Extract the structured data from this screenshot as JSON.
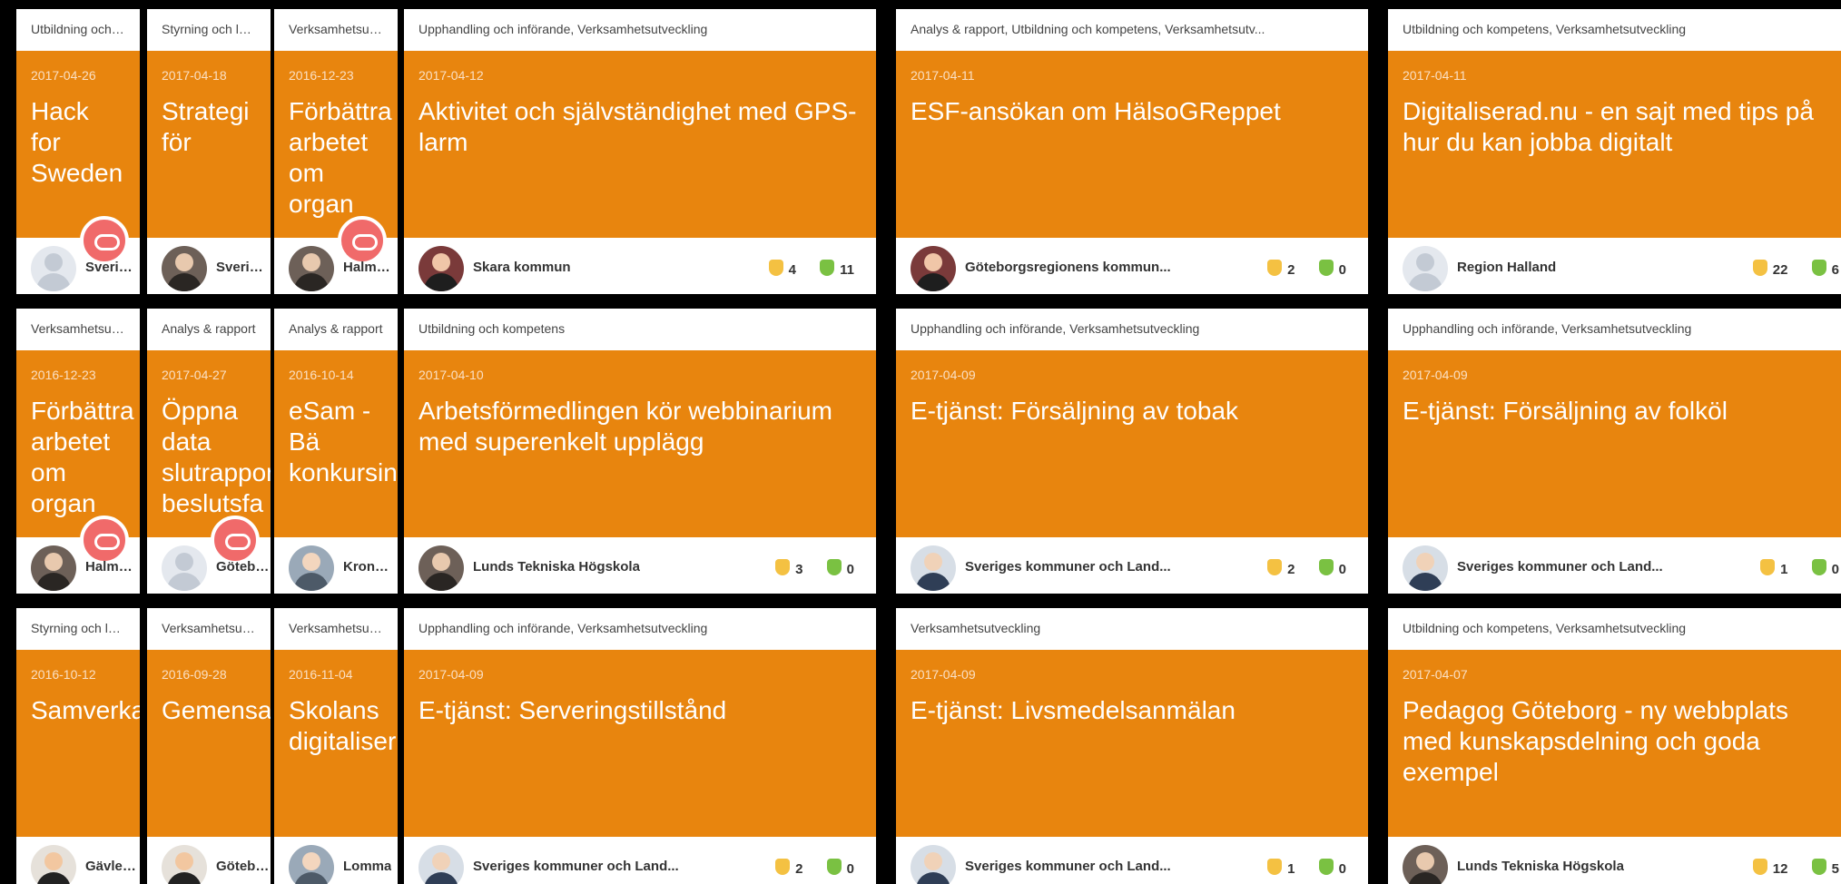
{
  "cards": [
    {
      "category": "Utbildning och kompetens",
      "date": "2017-04-26",
      "title": "Hack for Sweden",
      "org": "Sveriges kommuner",
      "thumbs": "",
      "people": ""
    },
    {
      "category": "Styrning och ledning",
      "date": "2017-04-18",
      "title": "Strategi för",
      "org": "Sveriges",
      "thumbs": "",
      "people": ""
    },
    {
      "category": "Verksamhetsutveckling",
      "date": "2016-12-23",
      "title": "Förbättra arbetet om organ",
      "org": "Halmstad",
      "thumbs": "",
      "people": ""
    },
    {
      "category": "Upphandling och införande, Verksamhetsutveckling",
      "date": "2017-04-12",
      "title": "Aktivitet och självständighet med GPS-larm",
      "org": "Skara kommun",
      "thumbs": "4",
      "people": "11"
    },
    {
      "category": "Analys & rapport, Utbildning och kompetens, Verksamhetsutv...",
      "date": "2017-04-11",
      "title": "ESF-ansökan om HälsoGReppet",
      "org": "Göteborgsregionens kommun...",
      "thumbs": "2",
      "people": "0"
    },
    {
      "category": "Utbildning och kompetens, Verksamhetsutveckling",
      "date": "2017-04-11",
      "title": "Digitaliserad.nu - en sajt med tips på hur du kan jobba digitalt",
      "org": "Region Halland",
      "thumbs": "22",
      "people": "6"
    },
    {
      "category": "Verksamhetsutveckling",
      "date": "2016-12-23",
      "title": "Förbättra arbetet om organ",
      "org": "Halmstad",
      "thumbs": "",
      "people": ""
    },
    {
      "category": "Analys & rapport",
      "date": "2017-04-27",
      "title": "Öppna data slutrapport beslutsfa",
      "org": "Göteborg",
      "thumbs": "",
      "people": ""
    },
    {
      "category": "Analys & rapport",
      "date": "2016-10-14",
      "title": "eSam - Bä konkursin",
      "org": "Kronofogden",
      "thumbs": "",
      "people": ""
    },
    {
      "category": "Utbildning och kompetens",
      "date": "2017-04-10",
      "title": "Arbetsförmedlingen kör webbinarium med superenkelt upplägg",
      "org": "Lunds Tekniska Högskola",
      "thumbs": "3",
      "people": "0"
    },
    {
      "category": "Upphandling och införande, Verksamhetsutveckling",
      "date": "2017-04-09",
      "title": "E-tjänst: Försäljning av tobak",
      "org": "Sveriges kommuner och Land...",
      "thumbs": "2",
      "people": "0"
    },
    {
      "category": "Upphandling och införande, Verksamhetsutveckling",
      "date": "2017-04-09",
      "title": "E-tjänst: Försäljning av folköl",
      "org": "Sveriges kommuner och Land...",
      "thumbs": "1",
      "people": "0"
    },
    {
      "category": "Styrning och ledning",
      "date": "2016-10-12",
      "title": "Samverkan",
      "org": "Gävle kommun",
      "thumbs": "",
      "people": ""
    },
    {
      "category": "Verksamhetsutveckling",
      "date": "2016-09-28",
      "title": "Gemensam",
      "org": "Göteborg",
      "thumbs": "",
      "people": ""
    },
    {
      "category": "Verksamhetsutveckling",
      "date": "2016-11-04",
      "title": "Skolans digitaliser",
      "org": "Lomma",
      "thumbs": "",
      "people": ""
    },
    {
      "category": "Upphandling och införande, Verksamhetsutveckling",
      "date": "2017-04-09",
      "title": "E-tjänst: Serveringstillstånd",
      "org": "Sveriges kommuner och Land...",
      "thumbs": "2",
      "people": "0"
    },
    {
      "category": "Verksamhetsutveckling",
      "date": "2017-04-09",
      "title": "E-tjänst: Livsmedelsanmälan",
      "org": "Sveriges kommuner och Land...",
      "thumbs": "1",
      "people": "0"
    },
    {
      "category": "Utbildning och kompetens, Verksamhetsutveckling",
      "date": "2017-04-07",
      "title": "Pedagog Göteborg - ny webbplats med kunskapsdelning och goda exempel",
      "org": "Lunds Tekniska Högskola",
      "thumbs": "12",
      "people": "5"
    }
  ]
}
